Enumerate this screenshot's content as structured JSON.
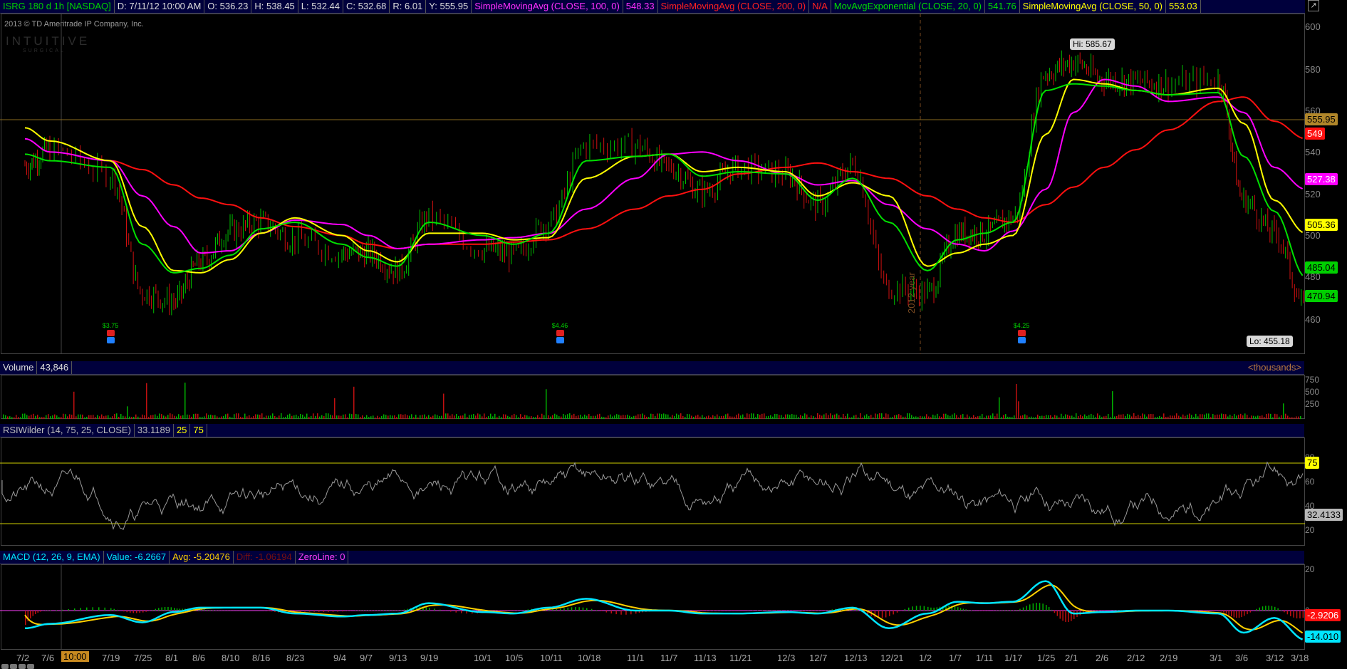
{
  "top_bar": {
    "symbol": "ISRG 180 d 1h [NASDAQ]",
    "datetime": "D: 7/11/12 10:00 AM",
    "open": "O: 536.23",
    "high": "H: 538.45",
    "low": "L: 532.44",
    "close": "C: 532.68",
    "range": "R: 6.01",
    "y": "Y: 555.95",
    "sma100_label": "SimpleMovingAvg (CLOSE, 100, 0)",
    "sma100_value": "548.33",
    "sma200_label": "SimpleMovingAvg (CLOSE, 200, 0)",
    "sma200_value": "N/A",
    "ema20_label": "MovAvgExponential (CLOSE, 20, 0)",
    "ema20_value": "541.76",
    "sma50_label": "SimpleMovingAvg (CLOSE, 50, 0)",
    "sma50_value": "553.03"
  },
  "copyright": "2013 © TD Ameritrade IP Company, Inc.",
  "watermark": {
    "name": "INTUITIVE",
    "sub": "SURGICAL"
  },
  "price_panel": {
    "ticks": [
      "600",
      "580",
      "560",
      "540",
      "520",
      "500",
      "480",
      "460"
    ],
    "hi_label": "Hi: 585.67",
    "lo_label": "Lo: 455.18",
    "year_label": "2012 year",
    "dividends": [
      "$3.75",
      "$4.46",
      "$4.25"
    ],
    "tags": {
      "y_price": "555.95",
      "sma200": "549",
      "sma100": "527.38",
      "sma50": "505.36",
      "ema20": "485.04",
      "last": "470.94"
    }
  },
  "volume_panel": {
    "label": "Volume",
    "value": "43,846",
    "units": "<thousands>",
    "ticks": [
      "750",
      "500",
      "250"
    ]
  },
  "rsi_panel": {
    "label": "RSIWilder (14, 75, 25, CLOSE)",
    "value": "33.1189",
    "lower": "25",
    "upper": "75",
    "ticks": [
      "80",
      "60",
      "40",
      "20"
    ],
    "tag_upper": "75",
    "tag_value": "32.4133"
  },
  "macd_panel": {
    "label": "MACD (12, 26, 9, EMA)",
    "value": "Value: -6.2667",
    "avg": "Avg: -5.20476",
    "diff": "Diff: -1.06194",
    "zeroline": "ZeroLine: 0",
    "ticks": [
      "20",
      "0"
    ],
    "tag_avg": "-2.9206",
    "tag_value": "-14.010"
  },
  "dates": [
    "7/2",
    "7/6",
    "7/19",
    "7/25",
    "8/1",
    "8/6",
    "8/10",
    "8/16",
    "8/23",
    "9/4",
    "9/7",
    "9/13",
    "9/19",
    "10/1",
    "10/5",
    "10/11",
    "10/18",
    "11/1",
    "11/7",
    "11/13",
    "11/21",
    "12/3",
    "12/7",
    "12/13",
    "12/21",
    "1/2",
    "1/7",
    "1/11",
    "1/17",
    "1/25",
    "2/1",
    "2/6",
    "2/12",
    "2/19",
    "3/1",
    "3/6",
    "3/12",
    "3/18"
  ],
  "cursor_time": "10:00",
  "colors": {
    "ema20": "#00e000",
    "sma50": "#ffff00",
    "sma100": "#ff00ff",
    "sma200": "#ff1010",
    "macd_value": "#00e5ff",
    "macd_avg": "#ffd000",
    "rsi": "#9a9a9a",
    "header_bg": "#00003c"
  },
  "chart_data": {
    "type": "line",
    "title": "ISRG 180 d 1h [NASDAQ]",
    "x": [
      "7/2",
      "7/6",
      "7/19",
      "7/25",
      "8/1",
      "8/6",
      "8/10",
      "8/16",
      "8/23",
      "9/4",
      "9/7",
      "9/13",
      "9/19",
      "10/1",
      "10/5",
      "10/11",
      "10/18",
      "11/1",
      "11/7",
      "11/13",
      "11/21",
      "12/3",
      "12/7",
      "12/13",
      "12/21",
      "1/2",
      "1/7",
      "1/11",
      "1/17",
      "1/25",
      "2/1",
      "2/6",
      "2/12",
      "2/19",
      "3/1",
      "3/6",
      "3/12",
      "3/18"
    ],
    "ylim": [
      450,
      605
    ],
    "series": [
      {
        "name": "SimpleMovingAvg (CLOSE, 100, 0)",
        "values": [
          548,
          542,
          538,
          522,
          508,
          496,
          497,
          505,
          511,
          509,
          504,
          498,
          500,
          502,
          503,
          505,
          516,
          530,
          541,
          542,
          538,
          532,
          527,
          529,
          518,
          507,
          500,
          497,
          506,
          525,
          560,
          575,
          572,
          565,
          567,
          560,
          535,
          525
        ]
      },
      {
        "name": "SimpleMovingAvg (CLOSE, 200, 0)",
        "values": [
          null,
          null,
          538,
          534,
          527,
          521,
          518,
          512,
          508,
          504,
          500,
          498,
          500,
          500,
          501,
          502,
          507,
          516,
          522,
          525,
          532,
          535,
          537,
          533,
          530,
          522,
          516,
          512,
          510,
          518,
          526,
          535,
          543,
          552,
          565,
          567,
          556,
          548
        ]
      },
      {
        "name": "MovAvgExponential (CLOSE, 20, 0)",
        "values": [
          541,
          538,
          535,
          500,
          487,
          489,
          495,
          507,
          510,
          500,
          494,
          490,
          510,
          504,
          500,
          505,
          538,
          540,
          541,
          531,
          533,
          532,
          520,
          530,
          510,
          488,
          502,
          505,
          510,
          570,
          573,
          572,
          570,
          568,
          569,
          540,
          515,
          485
        ]
      },
      {
        "name": "SimpleMovingAvg (CLOSE, 50, 0)",
        "values": [
          553,
          547,
          538,
          508,
          488,
          487,
          493,
          505,
          512,
          504,
          497,
          492,
          505,
          505,
          502,
          503,
          530,
          540,
          541,
          533,
          535,
          533,
          522,
          528,
          522,
          490,
          496,
          500,
          504,
          550,
          575,
          573,
          570,
          568,
          571,
          555,
          520,
          505
        ]
      },
      {
        "name": "Price",
        "values": [
          536,
          543,
          532,
          478,
          474,
          492,
          506,
          510,
          502,
          496,
          496,
          488,
          512,
          498,
          495,
          510,
          545,
          545,
          535,
          524,
          535,
          532,
          518,
          536,
          480,
          478,
          505,
          505,
          512,
          578,
          583,
          575,
          574,
          573,
          575,
          520,
          505,
          471
        ]
      }
    ]
  }
}
